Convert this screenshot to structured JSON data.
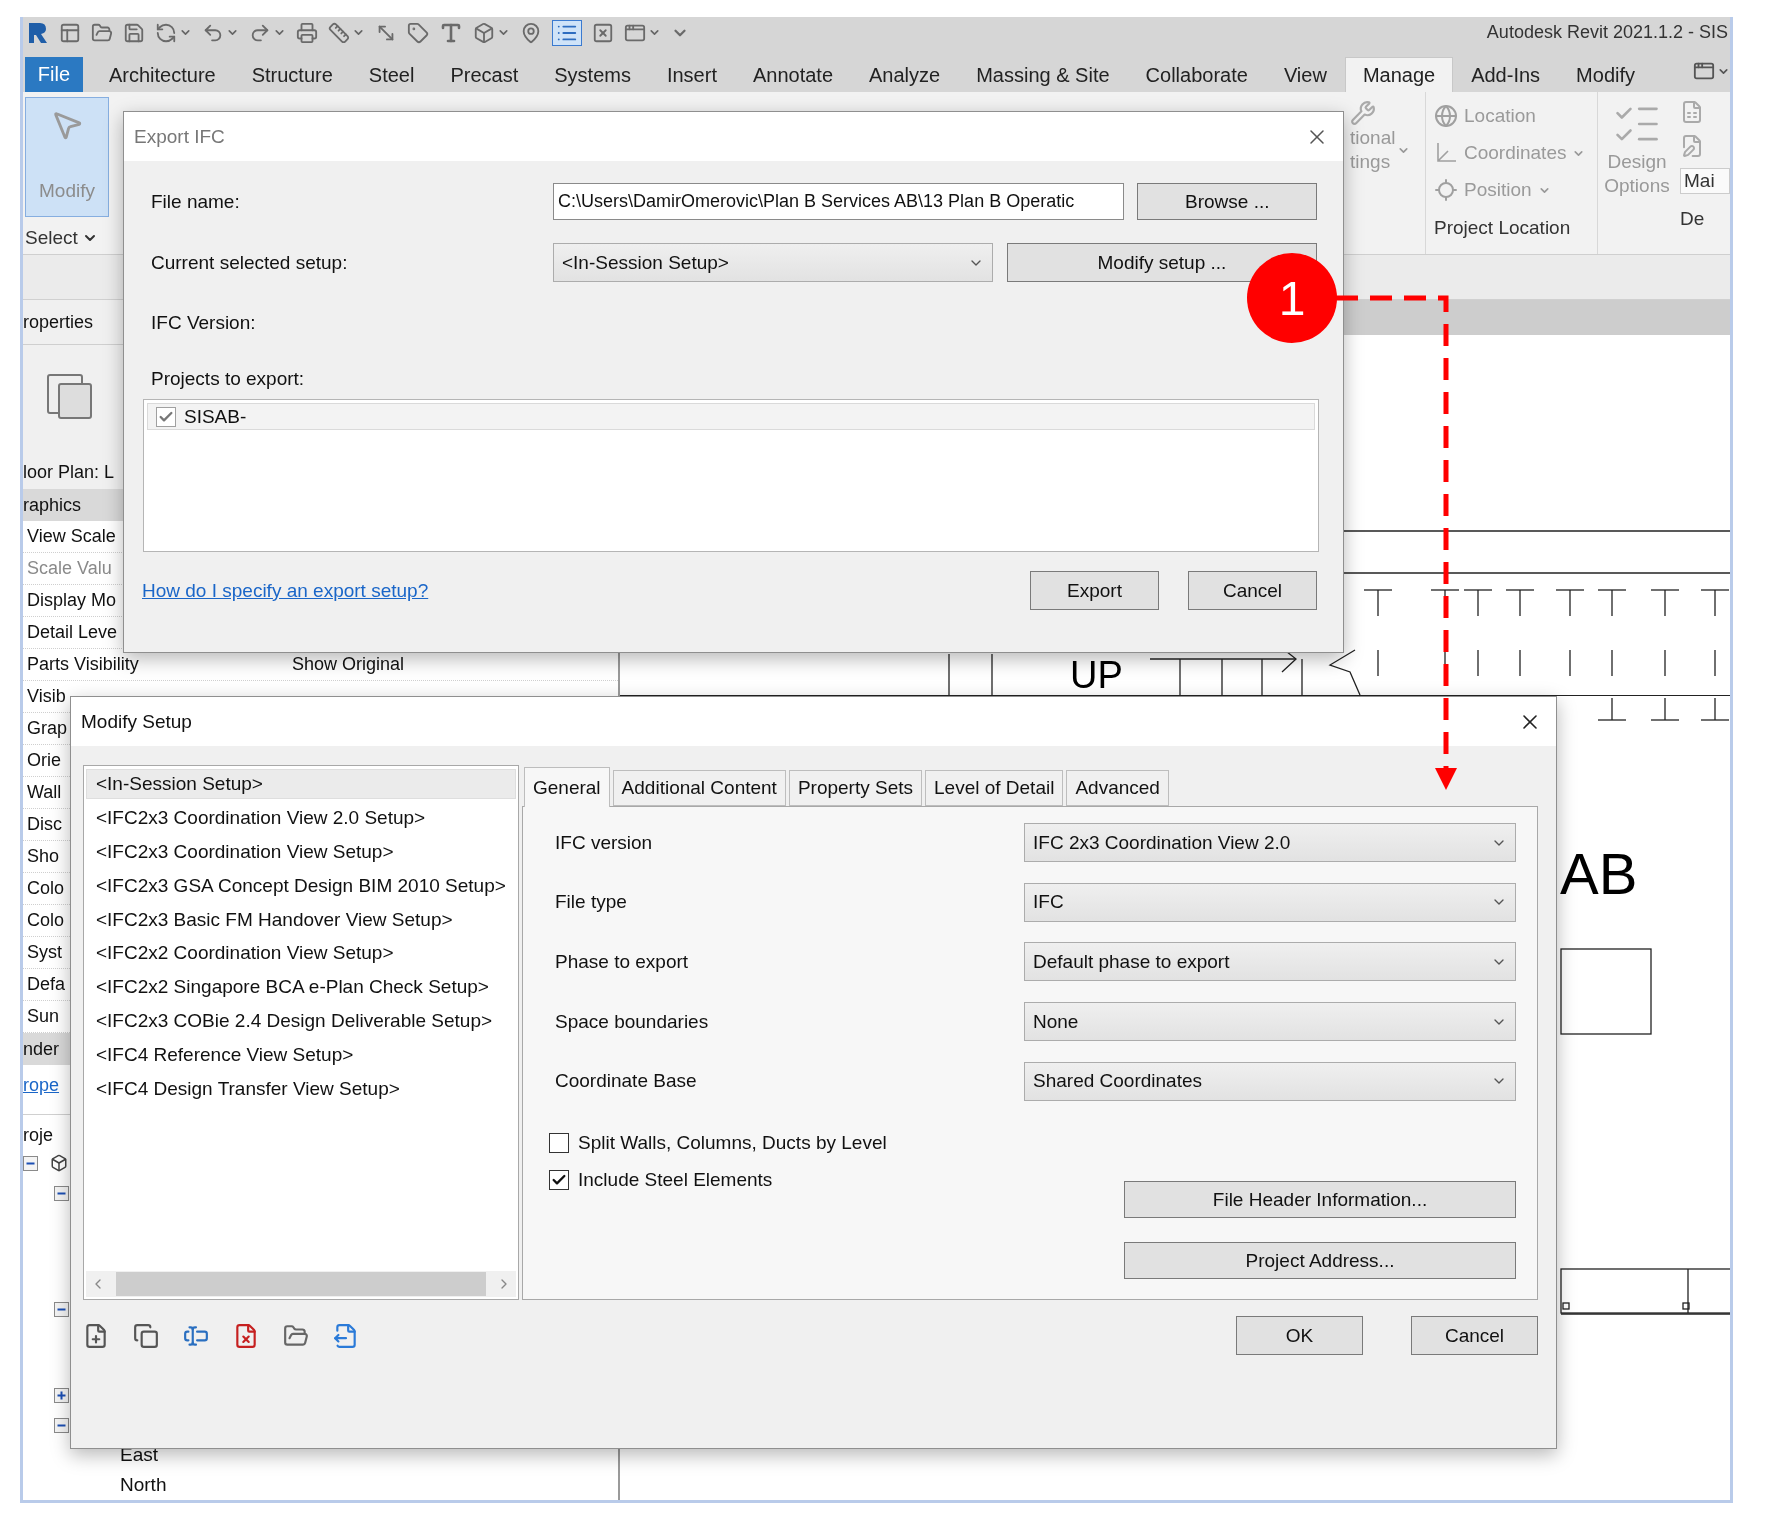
{
  "app": {
    "title": "Autodesk Revit 2021.1.2 - SIS",
    "file_tab": "File",
    "tabs": [
      {
        "label": "Architecture",
        "selected": false
      },
      {
        "label": "Structure",
        "selected": false
      },
      {
        "label": "Steel",
        "selected": false
      },
      {
        "label": "Precast",
        "selected": false
      },
      {
        "label": "Systems",
        "selected": false
      },
      {
        "label": "Insert",
        "selected": false
      },
      {
        "label": "Annotate",
        "selected": false
      },
      {
        "label": "Analyze",
        "selected": false
      },
      {
        "label": "Massing & Site",
        "selected": false
      },
      {
        "label": "Collaborate",
        "selected": false
      },
      {
        "label": "View",
        "selected": false
      },
      {
        "label": "Manage",
        "selected": true
      },
      {
        "label": "Add-Ins",
        "selected": false
      },
      {
        "label": "Modify",
        "selected": false
      }
    ],
    "ribbon": {
      "modify_button": "Modify",
      "select_label": "Select",
      "cut_button": [
        "tional",
        "tings"
      ],
      "location_tools": [
        {
          "label": "Location",
          "dropdown": false,
          "disabled": true
        },
        {
          "label": "Coordinates",
          "dropdown": true,
          "disabled": true
        },
        {
          "label": "Position",
          "dropdown": true,
          "disabled": true
        }
      ],
      "location_group": "Project Location",
      "design_options": [
        "Design",
        "Options"
      ],
      "option_field": "Mai",
      "cut_group": "De"
    }
  },
  "properties": {
    "title": "roperties",
    "view_type": "loor Plan: L",
    "section": "raphics",
    "rows": [
      {
        "label": "View Scale",
        "disabled": false
      },
      {
        "label": "Scale Valu",
        "disabled": true
      },
      {
        "label": "Display Mo",
        "disabled": false
      },
      {
        "label": "Detail Leve",
        "disabled": false
      },
      {
        "label": "Parts Visibility",
        "value": "Show Original",
        "disabled": false
      },
      {
        "label": "Visib",
        "disabled": false
      },
      {
        "label": "Grap",
        "disabled": false
      },
      {
        "label": "Orie",
        "disabled": false
      },
      {
        "label": "Wall",
        "disabled": false
      },
      {
        "label": "Disc",
        "disabled": false
      },
      {
        "label": "Sho",
        "disabled": false
      },
      {
        "label": "Colo",
        "disabled": false
      },
      {
        "label": "Colo",
        "disabled": false
      },
      {
        "label": "Syst",
        "disabled": false
      },
      {
        "label": "Defa",
        "disabled": false
      },
      {
        "label": "Sun",
        "disabled": false
      }
    ],
    "section_2": "nder",
    "help_link": "rope"
  },
  "project_browser": {
    "title": "roje",
    "tree": [
      {
        "expanded": true,
        "children": [
          {
            "expanded": true
          },
          {
            "expanded": true
          },
          {
            "expanded": false
          },
          {
            "expanded": true,
            "children": [
              {
                "label": "East"
              },
              {
                "label": "North"
              }
            ]
          }
        ]
      }
    ]
  },
  "view": {
    "labels": [
      "UP",
      "AB"
    ]
  },
  "export_ifc": {
    "title": "Export IFC",
    "file_name_label": "File name:",
    "file_name": "C:\\Users\\DamirOmerovic\\Plan B Services AB\\13 Plan B Operatic",
    "browse": "Browse ...",
    "setup_label": "Current selected setup:",
    "setup": "<In-Session Setup>",
    "modify_setup": "Modify setup ...",
    "version_label": "IFC Version:",
    "projects_label": "Projects to export:",
    "projects": [
      {
        "label": "SISAB-",
        "checked": true,
        "selected": true
      }
    ],
    "help_link": "How do I specify an export setup?",
    "buttons": [
      "Export",
      "Cancel"
    ]
  },
  "modify_setup": {
    "title": "Modify Setup",
    "setups": [
      {
        "label": "<In-Session Setup>",
        "selected": true
      },
      {
        "label": "<IFC2x3 Coordination View 2.0 Setup>",
        "selected": false
      },
      {
        "label": "<IFC2x3 Coordination View Setup>",
        "selected": false
      },
      {
        "label": "<IFC2x3 GSA Concept Design BIM 2010 Setup>",
        "selected": false
      },
      {
        "label": "<IFC2x3 Basic FM Handover View Setup>",
        "selected": false
      },
      {
        "label": "<IFC2x2 Coordination View Setup>",
        "selected": false
      },
      {
        "label": "<IFC2x2 Singapore BCA e-Plan Check Setup>",
        "selected": false
      },
      {
        "label": "<IFC2x3 COBie 2.4 Design Deliverable Setup>",
        "selected": false
      },
      {
        "label": "<IFC4 Reference View Setup>",
        "selected": false
      },
      {
        "label": "<IFC4 Design Transfer View Setup>",
        "selected": false
      }
    ],
    "tabs": [
      {
        "label": "General",
        "selected": true
      },
      {
        "label": "Additional Content",
        "selected": false
      },
      {
        "label": "Property Sets",
        "selected": false
      },
      {
        "label": "Level of Detail",
        "selected": false
      },
      {
        "label": "Advanced",
        "selected": false
      }
    ],
    "fields": [
      {
        "label": "IFC version",
        "value": "IFC 2x3 Coordination View 2.0"
      },
      {
        "label": "File type",
        "value": "IFC"
      },
      {
        "label": "Phase to export",
        "value": "Default phase to export"
      },
      {
        "label": "Space boundaries",
        "value": "None"
      },
      {
        "label": "Coordinate Base",
        "value": "Shared Coordinates"
      }
    ],
    "options": [
      {
        "label": "Split Walls, Columns, Ducts by Level",
        "checked": false
      },
      {
        "label": "Include Steel Elements",
        "checked": true
      }
    ],
    "side_buttons": [
      "File Header Information...",
      "Project Address..."
    ],
    "buttons": [
      "OK",
      "Cancel"
    ]
  },
  "callout": {
    "number": "1"
  }
}
